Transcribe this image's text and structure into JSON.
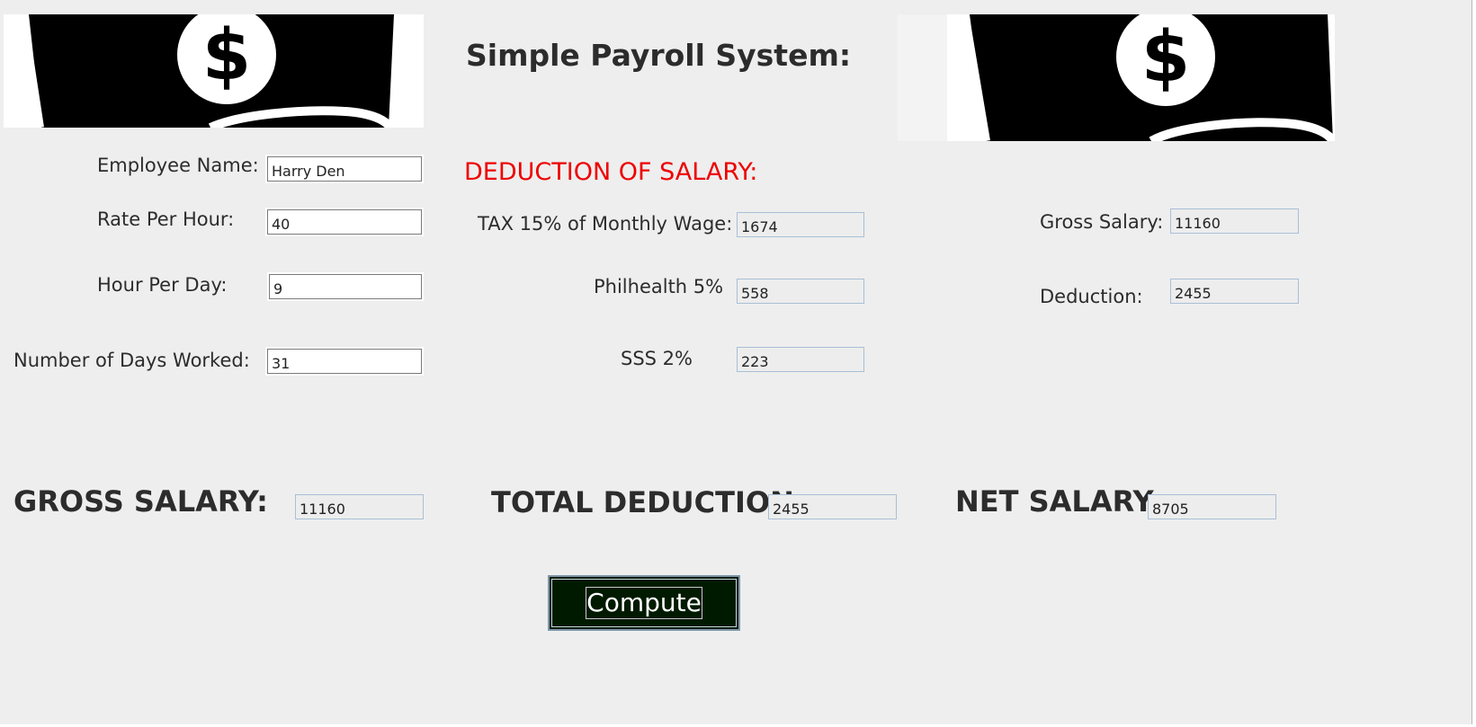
{
  "app": {
    "title": "Simple Payroll System:"
  },
  "icons": {
    "left_banner": "money-dollar-bill-icon",
    "right_banner": "money-dollar-bill-icon"
  },
  "colors": {
    "deduction_heading": "#ee0000",
    "compute_bg": "#001a00",
    "window_bg": "#eeeeee"
  },
  "employee": {
    "name_label": "Employee Name:",
    "name_value": "Harry Den",
    "rate_label": "Rate Per Hour:",
    "rate_value": "40",
    "hours_label": "Hour Per Day:",
    "hours_value": "9",
    "days_label": "Number of Days Worked:",
    "days_value": "31"
  },
  "deductions": {
    "heading": "DEDUCTION OF SALARY:",
    "tax_label": "TAX 15% of Monthly Wage:",
    "tax_value": "1674",
    "philhealth_label": "Philhealth 5%",
    "philhealth_value": "558",
    "sss_label": "SSS 2%",
    "sss_value": "223"
  },
  "summary": {
    "gross_label": "Gross Salary:",
    "gross_value": "11160",
    "deduction_label": "Deduction:",
    "deduction_value": "2455"
  },
  "totals": {
    "gross_label": "GROSS SALARY:",
    "gross_value": "11160",
    "total_deduction_label": "TOTAL DEDUCTION:",
    "total_deduction_value": "2455",
    "net_label": "NET SALARY:",
    "net_value": "8705"
  },
  "actions": {
    "compute_label": "Compute"
  }
}
